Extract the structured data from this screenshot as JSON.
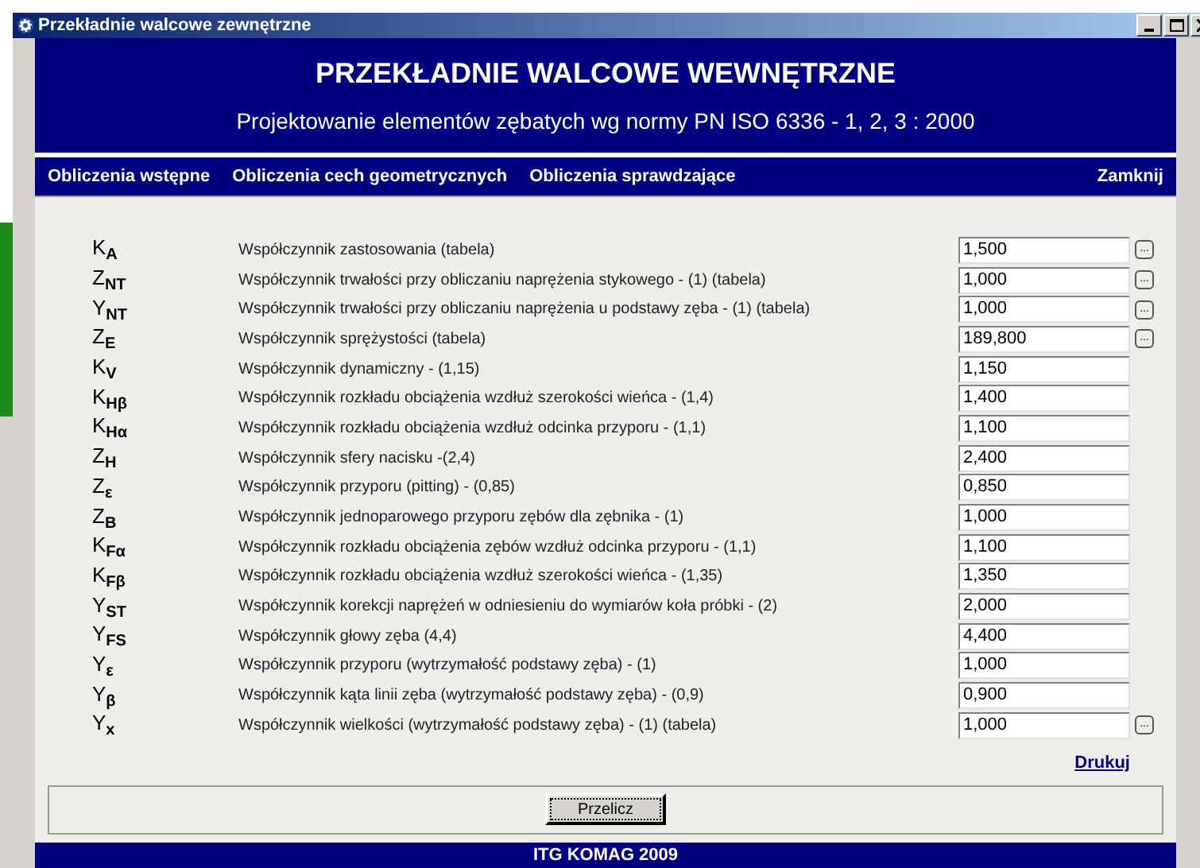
{
  "window": {
    "title": "Przekładnie walcowe zewnętrzne"
  },
  "header": {
    "title": "PRZEKŁADNIE WALCOWE WEWNĘTRZNE",
    "subtitle": "Projektowanie elementów zębatych wg normy PN ISO 6336 - 1, 2, 3 : 2000"
  },
  "menu": [
    "Obliczenia wstępne",
    "Obliczenia cech geometrycznych",
    "Obliczenia sprawdzające"
  ],
  "close_link": "Zamknij",
  "rows": [
    {
      "symbol": "K$_{A}$",
      "description": "Współczynnik zastosowania (tabela)",
      "value": "1,500",
      "picker": "..."
    },
    {
      "symbol": "Z$_{NT}$",
      "description": "Współczynnik trwałości przy obliczaniu naprężenia stykowego - (1) (tabela)",
      "value": "1,000",
      "picker": "..."
    },
    {
      "symbol": "Y$_{NT}$",
      "description": "Współczynnik trwałości przy obliczaniu naprężenia u podstawy zęba - (1) (tabela)",
      "value": "1,000",
      "picker": "..."
    },
    {
      "symbol": "Z$_{E}$",
      "description": "Współczynnik sprężystości (tabela)",
      "value": "189,800",
      "picker": "..."
    },
    {
      "symbol": "K$_{V}$",
      "description": "Współczynnik dynamiczny - (1,15)",
      "value": "1,150"
    },
    {
      "symbol": "K$_{Hβ}$",
      "description": "Współczynnik rozkładu obciążenia wzdłuż szerokości wieńca - (1,4)",
      "value": "1,400"
    },
    {
      "symbol": "K$_{Hα}$",
      "description": "Współczynnik rozkładu obciążenia wzdłuż odcinka przyporu - (1,1)",
      "value": "1,100"
    },
    {
      "symbol": "Z$_{H}$",
      "description": "Współczynnik sfery nacisku -(2,4)",
      "value": "2,400"
    },
    {
      "symbol": "Z$_{ε}$",
      "description": "Współczynnik przyporu (pitting) - (0,85)",
      "value": "0,850"
    },
    {
      "symbol": "Z$_{B}$",
      "description": "Współczynnik jednoparowego przyporu zębów dla zębnika - (1)",
      "value": "1,000"
    },
    {
      "symbol": "K$_{Fα}$",
      "description": "Współczynnik rozkładu obciążenia zębów wzdłuż odcinka przyporu - (1,1)",
      "value": "1,100"
    },
    {
      "symbol": "K$_{Fβ}$",
      "description": "Współczynnik rozkładu obciążenia wzdłuż szerokości wieńca - (1,35)",
      "value": "1,350"
    },
    {
      "symbol": "Y$_{ST}$",
      "description": "Współczynnik korekcji naprężeń w odniesieniu do wymiarów koła próbki - (2)",
      "value": "2,000"
    },
    {
      "symbol": "Y$_{FS}$",
      "description": "Współczynnik głowy zęba (4,4)",
      "value": "4,400"
    },
    {
      "symbol": "Y$_{ε}$",
      "description": "Współczynnik przyporu (wytrzymałość podstawy zęba) - (1)",
      "value": "1,000"
    },
    {
      "symbol": "Y$_{β}$",
      "description": "Współczynnik kąta linii zęba (wytrzymałość podstawy zęba) - (0,9)",
      "value": "0,900"
    },
    {
      "symbol": "Y$_{x}$",
      "description": "Współczynnik wielkości (wytrzymałość podstawy zęba) - (1) (tabela)",
      "value": "1,000",
      "picker": "..."
    }
  ],
  "print_link": "Drukuj",
  "calculate_button": "Przelicz",
  "footer": "ITG KOMAG 2009"
}
